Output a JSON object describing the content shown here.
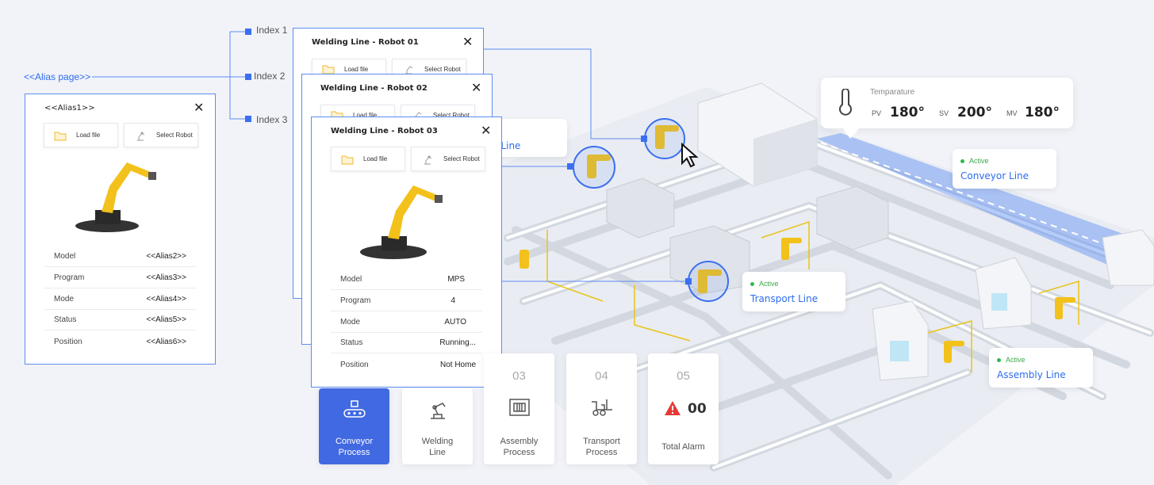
{
  "alias_page_link": "<<Alias page>>",
  "indexes": [
    "Index 1",
    "Index 2",
    "Index 3"
  ],
  "alias_card": {
    "title": "<<Alias1>>",
    "load_file": "Load file",
    "select_robot": "Select Robot",
    "rows": [
      {
        "key": "Model",
        "value": "<<Alias2>>"
      },
      {
        "key": "Program",
        "value": "<<Alias3>>"
      },
      {
        "key": "Mode",
        "value": "<<Alias4>>"
      },
      {
        "key": "Status",
        "value": "<<Alias5>>"
      },
      {
        "key": "Position",
        "value": "<<Alias6>>"
      }
    ]
  },
  "robot_cards": [
    {
      "title": "Welding Line - Robot 01",
      "load_file": "Load file",
      "select_robot": "Select Robot"
    },
    {
      "title": "Welding Line - Robot 02",
      "load_file": "Load file",
      "select_robot": "Select Robot"
    },
    {
      "title": "Welding Line - Robot 03",
      "load_file": "Load file",
      "select_robot": "Select Robot",
      "rows": [
        {
          "key": "Model",
          "value": "MPS"
        },
        {
          "key": "Program",
          "value": "4"
        },
        {
          "key": "Mode",
          "value": "AUTO"
        },
        {
          "key": "Status",
          "value": "Running..."
        },
        {
          "key": "Position",
          "value": "Not Home"
        }
      ]
    }
  ],
  "hidden_line_label": "g Line",
  "temperature": {
    "title": "Temparature",
    "pv_label": "PV",
    "pv": "180°",
    "sv_label": "SV",
    "sv": "200°",
    "mv_label": "MV",
    "mv": "180°"
  },
  "line_tags": [
    {
      "status": "Active",
      "name": "Conveyor Line"
    },
    {
      "status": "Active",
      "name": "Transport Line"
    },
    {
      "status": "Active",
      "name": "Assembly Line"
    }
  ],
  "processes": [
    {
      "label": "Conveyor\nProcess",
      "icon": "conveyor-icon",
      "active": true
    },
    {
      "label": "Welding\nLine",
      "icon": "robot-arm-icon"
    },
    {
      "number": "03",
      "label": "Assembly\nProcess",
      "icon": "assembly-icon"
    },
    {
      "number": "04",
      "label": "Transport\nProcess",
      "icon": "forklift-icon"
    },
    {
      "number": "05",
      "label": "Total Alarm",
      "alarm_count": "00",
      "icon": "alarm-icon"
    }
  ],
  "colors": {
    "accent": "#4169e1",
    "link": "#2d6cf0",
    "active": "#2ebb4c",
    "robot": "#f2c11b",
    "alarm": "#e53935"
  }
}
